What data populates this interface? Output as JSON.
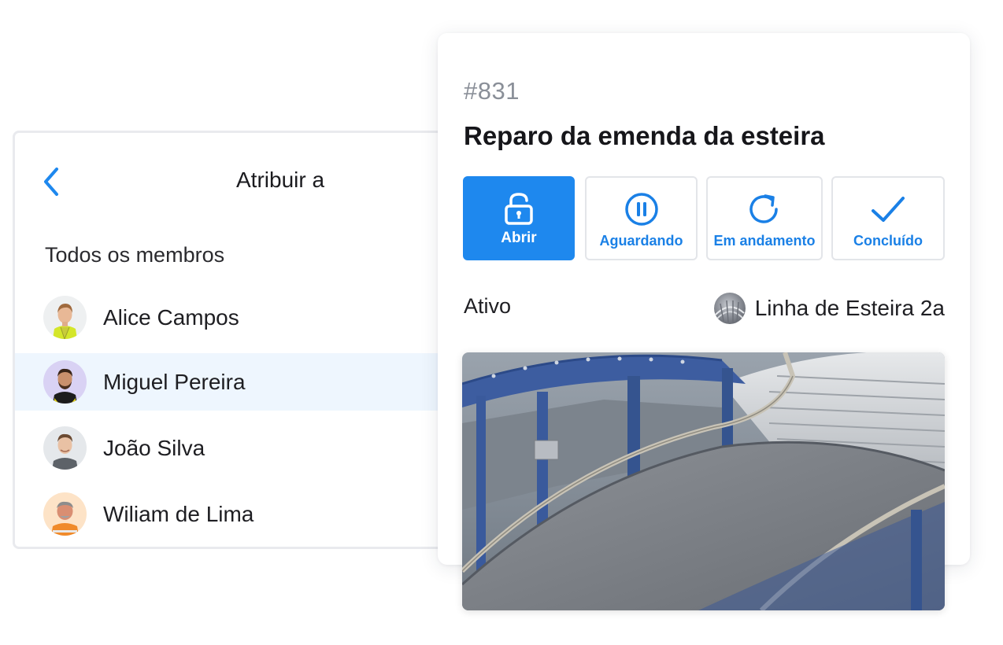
{
  "assign": {
    "title": "Atribuir a",
    "back_icon": "chevron-left-icon",
    "section_label": "Todos os membros",
    "members": [
      {
        "name": "Alice Campos",
        "selected": false
      },
      {
        "name": "Miguel Pereira",
        "selected": true
      },
      {
        "name": "João Silva",
        "selected": false
      },
      {
        "name": "Wiliam de Lima",
        "selected": false
      }
    ]
  },
  "work_order": {
    "id": "#831",
    "title": "Reparo da emenda da esteira",
    "statuses": [
      {
        "label": "Abrir",
        "icon": "unlock-icon",
        "active": true
      },
      {
        "label": "Aguardando",
        "icon": "pause-circle-icon",
        "active": false
      },
      {
        "label": "Em andamento",
        "icon": "refresh-icon",
        "active": false
      },
      {
        "label": "Concluído",
        "icon": "checkmark-icon",
        "active": false
      }
    ],
    "asset_status": "Ativo",
    "asset_name": "Linha de Esteira 2a"
  },
  "colors": {
    "accent": "#1e88ee",
    "selected_row": "#eef6fe",
    "id_gray": "#8a8f98"
  }
}
